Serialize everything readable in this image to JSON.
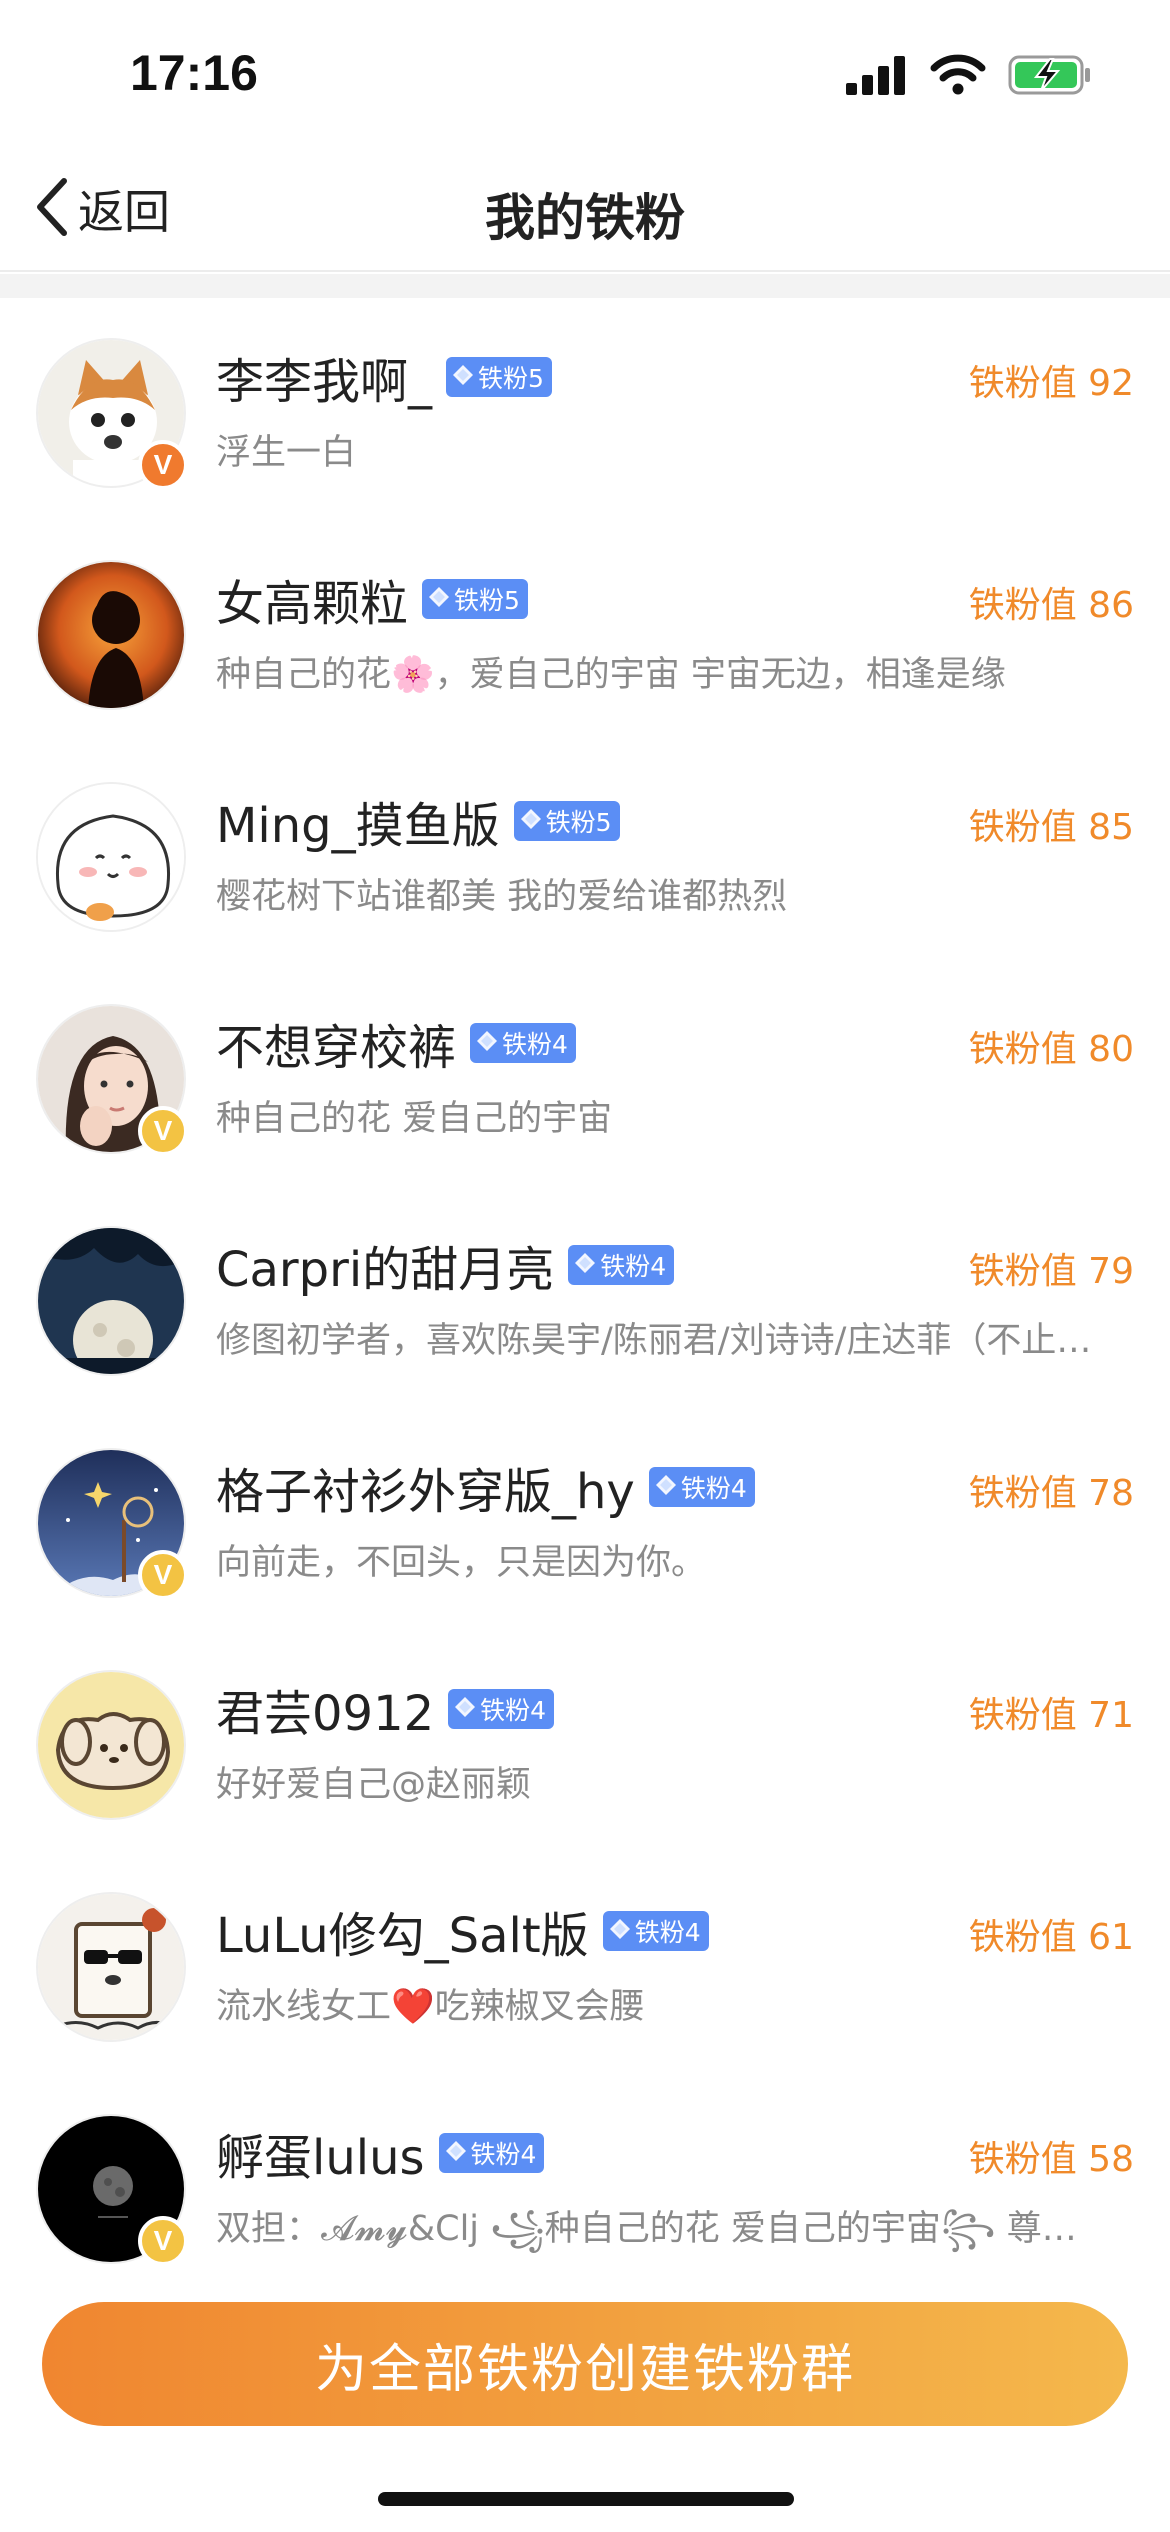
{
  "status_bar": {
    "time": "17:16",
    "icons": [
      "cellular-signal-icon",
      "wifi-icon",
      "battery-charging-icon"
    ],
    "battery_color": "#34c759"
  },
  "nav": {
    "back_label": "返回",
    "title": "我的铁粉"
  },
  "colors": {
    "accent": "#f08a2a",
    "badge": "#5b8ef5",
    "verify_orange": "#f07a2e",
    "verify_yellow": "#f3c343"
  },
  "fans": [
    {
      "name": "李李我啊_",
      "badge": "铁粉5",
      "bio": "浮生一白",
      "score": "铁粉值 92",
      "verify": "orange",
      "avatar_icon": "cat-avatar-icon"
    },
    {
      "name": "女高颗粒",
      "badge": "铁粉5",
      "bio": "种自己的花🌸，爱自己的宇宙 宇宙无边，相逢是缘",
      "score": "铁粉值 86",
      "verify": "none",
      "avatar_icon": "sunset-silhouette-avatar-icon"
    },
    {
      "name": "Ming_摸鱼版",
      "badge": "铁粉5",
      "bio": "樱花树下站谁都美 我的爱给谁都热烈",
      "score": "铁粉值 85",
      "verify": "none",
      "avatar_icon": "cartoon-bun-avatar-icon"
    },
    {
      "name": "不想穿校裤",
      "badge": "铁粉4",
      "bio": "种自己的花 爱自己的宇宙",
      "score": "铁粉值 80",
      "verify": "yellow",
      "avatar_icon": "girl-portrait-avatar-icon"
    },
    {
      "name": "Carpri的甜月亮",
      "badge": "铁粉4",
      "bio": "修图初学者，喜欢陈昊宇/陈丽君/刘诗诗/庄达菲（不止…",
      "score": "铁粉值 79",
      "verify": "none",
      "avatar_icon": "full-moon-night-avatar-icon"
    },
    {
      "name": "格子衬衫外穿版_hy",
      "badge": "铁粉4",
      "bio": "向前走，不回头，只是因为你。",
      "score": "铁粉值 78",
      "verify": "yellow",
      "avatar_icon": "starry-sky-avatar-icon"
    },
    {
      "name": "君芸0912",
      "badge": "铁粉4",
      "bio": "好好爱自己@赵丽颖",
      "score": "铁粉值 71",
      "verify": "none",
      "avatar_icon": "cartoon-dog-avatar-icon"
    },
    {
      "name": "LuLu修勾_Salt版",
      "badge": "铁粉4",
      "bio": "流水线女工❤️吃辣椒叉会腰",
      "score": "铁粉值 61",
      "verify": "none",
      "avatar_icon": "sunglasses-dog-avatar-icon"
    },
    {
      "name": "孵蛋lulus",
      "badge": "铁粉4",
      "bio": "双担：𝓐𝓶𝔂&Clj ꧁种自己的花 爱自己的宇宙꧂ 尊…",
      "score": "铁粉值 58",
      "verify": "yellow",
      "avatar_icon": "dark-moon-avatar-icon"
    }
  ],
  "footer": {
    "button_label": "为全部铁粉创建铁粉群"
  }
}
